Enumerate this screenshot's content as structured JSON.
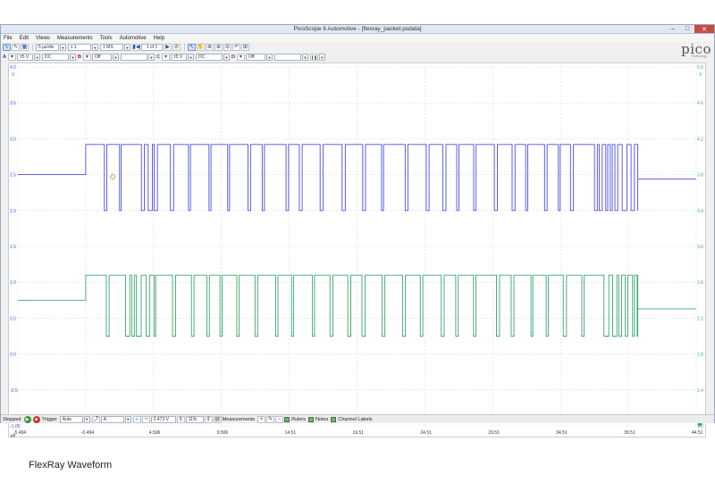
{
  "window": {
    "title": "PicoScope 6 Automotive - [flexray_packet.psdata]",
    "minimize": "–",
    "maximize": "□",
    "close": "✕"
  },
  "menu": [
    "File",
    "Edit",
    "Views",
    "Measurements",
    "Tools",
    "Automotive",
    "Help"
  ],
  "logo": {
    "text": "pico",
    "sub": "Technology"
  },
  "toolbar1": {
    "timebase": "5 µs/div",
    "zoom": "x 1",
    "samples": "1 MS",
    "buffer": "1 of 1"
  },
  "toolbar2": {
    "channels": [
      {
        "id": "A",
        "range": "±5 V",
        "coupling": "DC"
      },
      {
        "id": "B",
        "range": "",
        "coupling": "Off"
      },
      {
        "id": "C",
        "range": "±5 V",
        "coupling": "DC"
      },
      {
        "id": "D",
        "range": "",
        "coupling": "Off"
      }
    ]
  },
  "statusbar": {
    "state": "Stopped",
    "trigger_label": "Trigger",
    "trigger_mode": "Auto",
    "trigger_channel": "A",
    "trigger_level": "2.473 V",
    "pretrigger": "11%",
    "measurements": "Measurements",
    "rulers": "Rulers",
    "notes": "Notes",
    "channel_labels": "Channel Labels"
  },
  "caption": "FlexRay Waveform",
  "chart_data": {
    "type": "line",
    "x_ticks": [
      "-5.494",
      "-0.494",
      "4.506",
      "9.506",
      "14.51",
      "19.51",
      "24.51",
      "29.51",
      "34.51",
      "39.51",
      "44.51"
    ],
    "x_unit": "µs",
    "xlim": [
      -5.494,
      44.51
    ],
    "left_axis": {
      "unit": "V",
      "ticks": [
        "4.0",
        "3.5",
        "3.0",
        "2.5",
        "2.0",
        "1.5",
        "1.0",
        "0.5",
        "0.0",
        "-0.5",
        "-1.00"
      ],
      "ylim": [
        -1.0,
        4.0
      ]
    },
    "right_axis": {
      "unit": "V",
      "ticks": [
        "5.0",
        "4.6",
        "4.2",
        "3.8",
        "3.4",
        "3.0",
        "2.6",
        "2.2",
        "1.8",
        "1.4",
        "1.0"
      ],
      "ylim": [
        1.0,
        5.0
      ]
    },
    "colors": {
      "A": "#4a4ee0",
      "C": "#3aa86a",
      "grid": "#d6d9de"
    },
    "series": [
      {
        "name": "A",
        "idle": 2.5,
        "high": 2.92,
        "low": 2.0,
        "start_x": -0.494,
        "end_x": 40.2,
        "tail": 2.44
      },
      {
        "name": "C",
        "idle": 0.75,
        "high": 1.1,
        "low": 0.25,
        "start_x": -0.494,
        "end_x": 40.2,
        "tail": 0.63
      }
    ]
  }
}
